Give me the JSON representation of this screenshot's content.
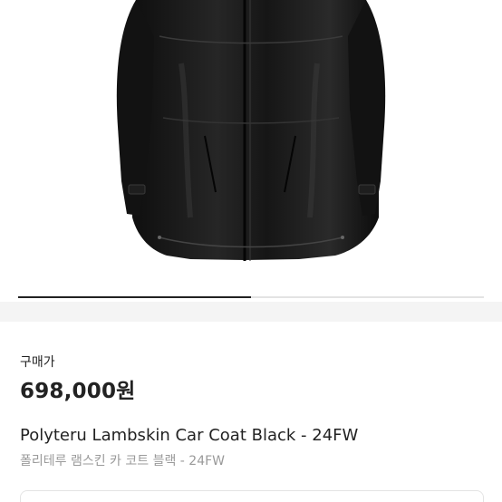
{
  "product": {
    "image": {
      "subject": "coat-photo",
      "colors": {
        "coat": "#161616",
        "highlight": "#3a3a3a",
        "background": "#ffffff"
      }
    },
    "carousel": {
      "progress": 0.5,
      "track_color": "#e3e3e3",
      "fill_color": "#222222"
    },
    "price_label": "구매가",
    "price": "698,000원",
    "title_en": "Polyteru Lambskin Car Coat Black - 24FW",
    "title_ko": "폴리테루 램스킨 카 코트 블랙 - 24FW"
  }
}
